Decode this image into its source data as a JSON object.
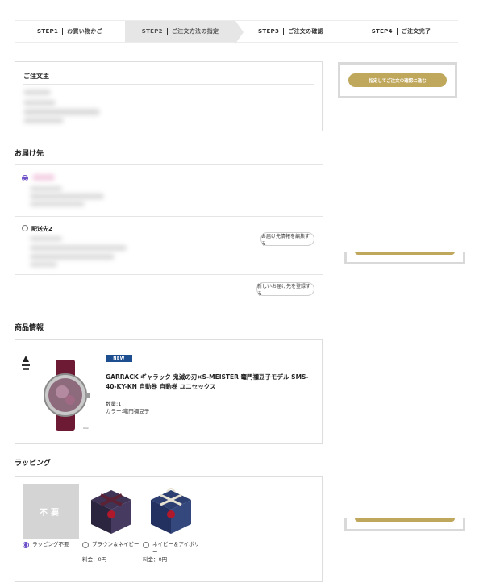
{
  "steps": [
    {
      "num": "STEP1",
      "label": "お買い物かご"
    },
    {
      "num": "STEP2",
      "label": "ご注文方法の指定"
    },
    {
      "num": "STEP3",
      "label": "ご注文の確認"
    },
    {
      "num": "STEP4",
      "label": "ご注文完了"
    }
  ],
  "orderer": {
    "title": "ご注文主"
  },
  "delivery": {
    "title": "お届け先",
    "address2_label": "配送先2",
    "edit_button": "お届け先情報を編集する",
    "register_button": "新しいお届け先を登録する"
  },
  "product_section": {
    "title": "商品情報",
    "badge": "NEW",
    "name": "GARRACK ギャラック 鬼滅の刃×S-MEISTER 竈門禰豆子モデル SMS-40-KY-KN 自動巻 自動巻 ユニセックス",
    "quantity": "数量:1",
    "color": "カラー:竈門禰豆子"
  },
  "wrapping": {
    "title": "ラッピング",
    "none_tile": "不要",
    "options": [
      {
        "label": "ラッピング不要",
        "price": ""
      },
      {
        "label": "ブラウン＆ネイビー",
        "price": "料金：0円"
      },
      {
        "label": "ネイビー＆アイボリー",
        "price": "料金：0円"
      }
    ]
  },
  "side": {
    "confirm_button": "指定してご注文の確認に進む"
  }
}
